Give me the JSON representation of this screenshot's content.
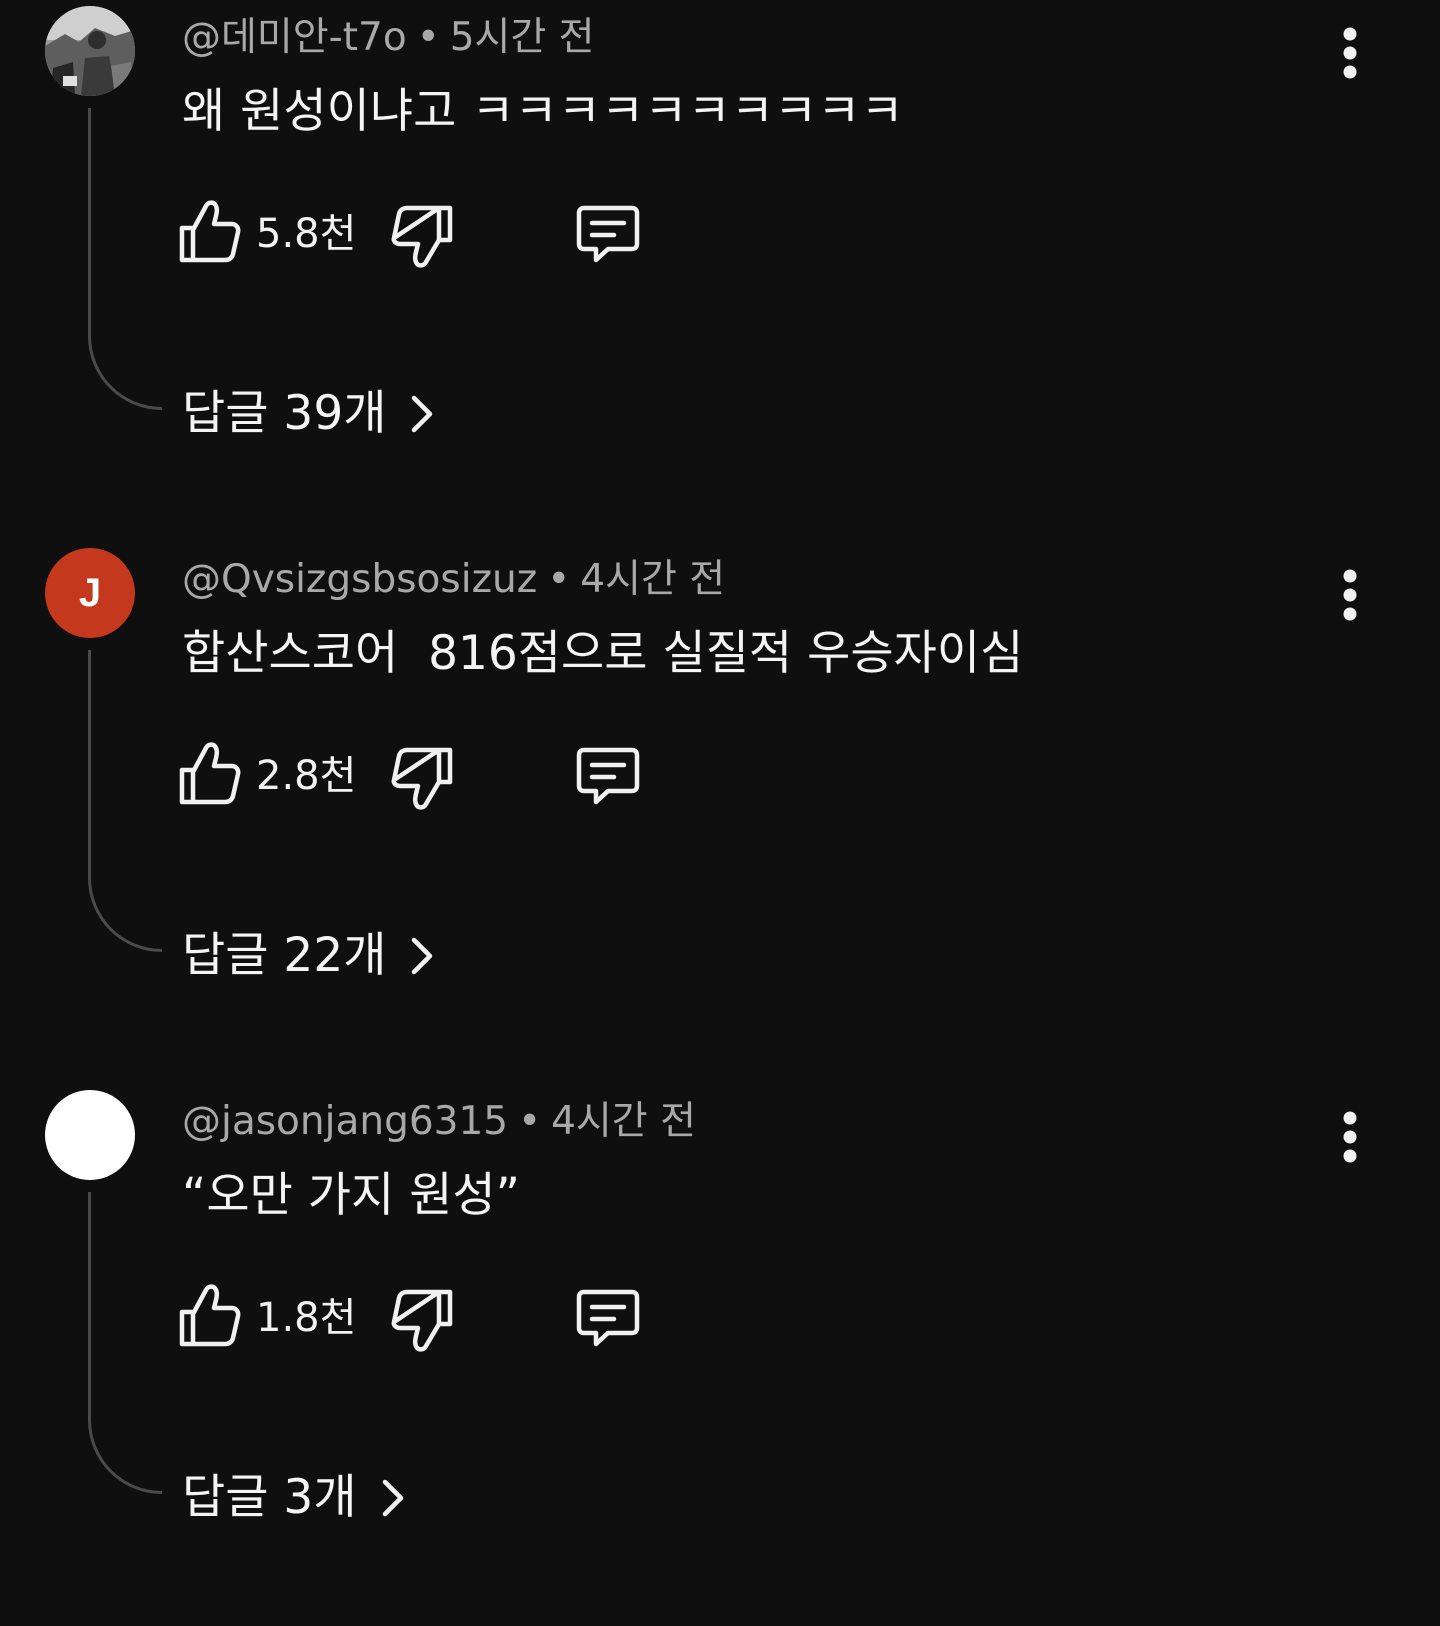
{
  "comments": [
    {
      "handle": "@데미안-t7o",
      "separator": "•",
      "time": "5시간 전",
      "text": "왜 원성이냐고 ㅋㅋㅋㅋㅋㅋㅋㅋㅋㅋ",
      "likes": "5.8천",
      "replies": "답글 39개",
      "avatar": "photo-avatar"
    },
    {
      "handle": "@Qvsizgsbsosizuz",
      "separator": "•",
      "time": "4시간 전",
      "text": "합산스코어  816점으로 실질적 우승자이심",
      "likes": "2.8천",
      "replies": "답글 22개",
      "avatar_letter": "J",
      "avatar_color": "#c4391d"
    },
    {
      "handle": "@jasonjang6315",
      "separator": "•",
      "time": "4시간 전",
      "text": "“오만 가지 원성”",
      "likes": "1.8천",
      "replies": "답글 3개",
      "avatar_color": "#ffffff"
    }
  ],
  "icons": {
    "like": "thumbs-up-icon",
    "dislike": "thumbs-down-icon",
    "reply": "comment-icon",
    "more": "more-vert-icon",
    "chevron": "chevron-right-icon"
  },
  "colors": {
    "background": "#0f0f10",
    "text": "#f1f1f1",
    "meta": "#a8a8a8",
    "thread": "#4a4a4a"
  }
}
